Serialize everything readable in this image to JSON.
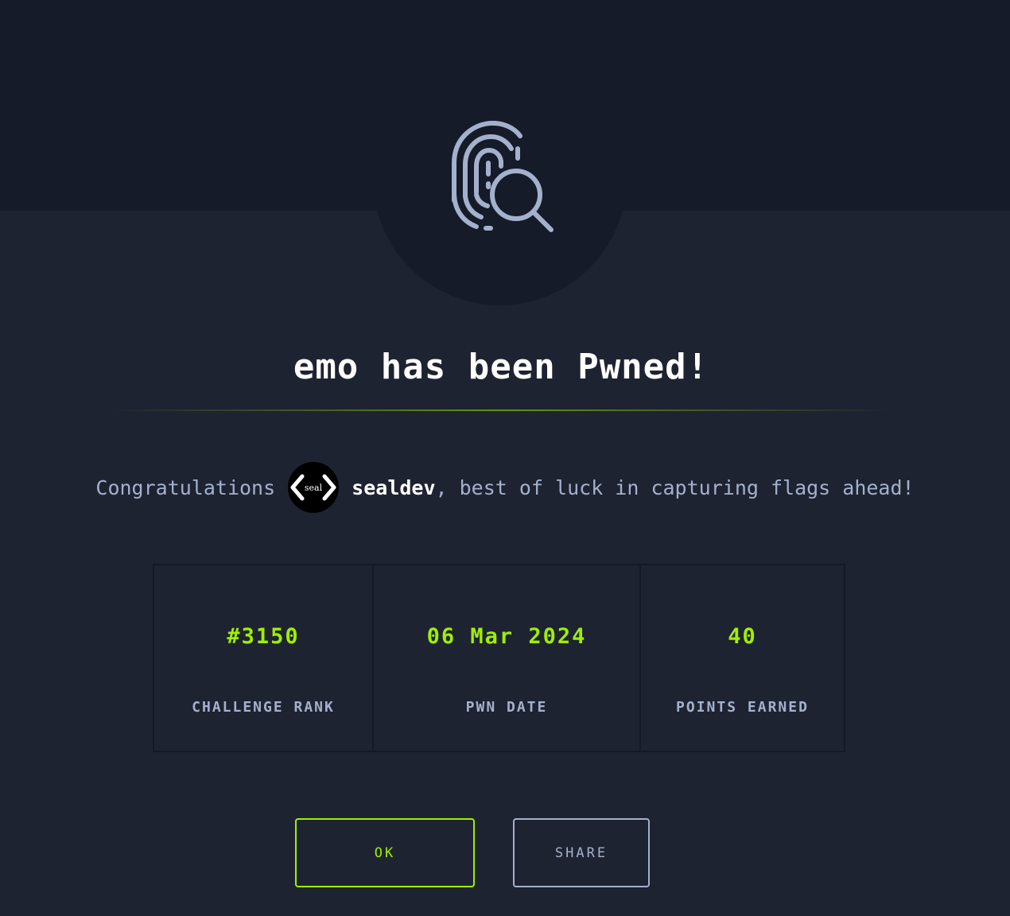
{
  "badge": {
    "icon": "fingerprint-search-icon"
  },
  "title": "emo has been Pwned!",
  "congrats": {
    "prefix": "Congratulations",
    "avatar_text": "seal",
    "username": "sealdev",
    "suffix": ", best of luck in capturing flags ahead!"
  },
  "stats": [
    {
      "value": "#3150",
      "label": "CHALLENGE RANK"
    },
    {
      "value": "06 Mar 2024",
      "label": "PWN DATE"
    },
    {
      "value": "40",
      "label": "POINTS EARNED"
    }
  ],
  "buttons": {
    "ok_label": "OK",
    "share_label": "SHARE"
  },
  "colors": {
    "accent": "#9fef00",
    "background": "#1e2331",
    "panel_dark": "#151b28",
    "muted_text": "#a4b1cd"
  }
}
